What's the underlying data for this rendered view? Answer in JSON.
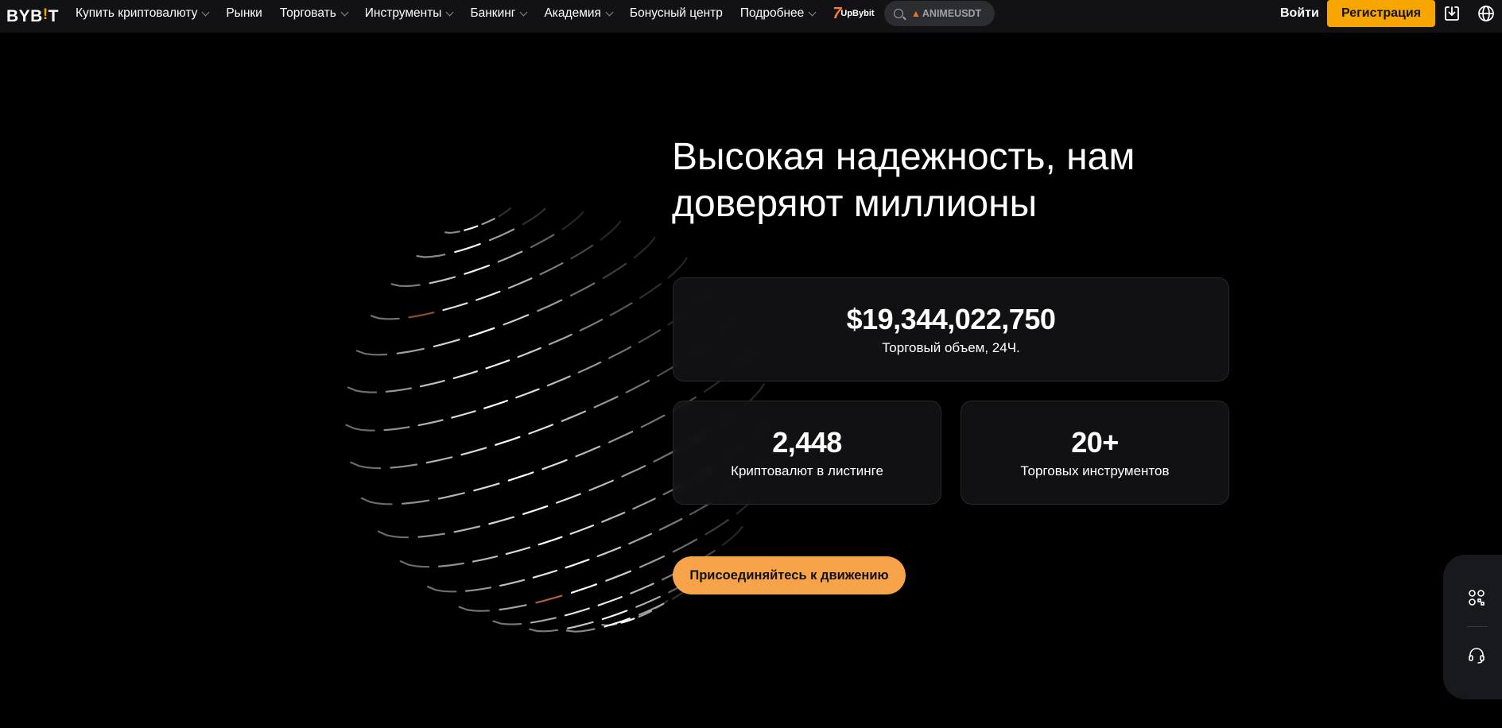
{
  "header": {
    "logo": {
      "text_main": "BYB",
      "text_accent": "!",
      "text_end": "T"
    },
    "nav": [
      {
        "label": "Купить криптовалюту",
        "dropdown": true
      },
      {
        "label": "Рынки",
        "dropdown": false
      },
      {
        "label": "Торговать",
        "dropdown": true
      },
      {
        "label": "Инструменты",
        "dropdown": true
      },
      {
        "label": "Банкинг",
        "dropdown": true
      },
      {
        "label": "Академия",
        "dropdown": true
      },
      {
        "label": "Бонусный центр",
        "dropdown": false
      },
      {
        "label": "Подробнее",
        "dropdown": true
      }
    ],
    "promo": {
      "seven": "7",
      "label": "UpBybit"
    },
    "search": {
      "placeholder": "ANIMEUSDT",
      "icon": "search-icon"
    },
    "login_label": "Войти",
    "register_label": "Регистрация",
    "icons": [
      "download-icon",
      "globe-icon"
    ]
  },
  "hero": {
    "title_line1": "Высокая надежность, нам",
    "title_line2": "доверяют миллионы",
    "stats": [
      {
        "value": "$19,344,022,750",
        "label": "Торговый объем, 24Ч."
      },
      {
        "value": "2,448",
        "label": "Криптовалют в листинге"
      },
      {
        "value": "20+",
        "label": "Торговых инструментов"
      }
    ],
    "cta_label": "Присоединяйтесь к движению"
  },
  "side_panel": {
    "icons": [
      "qr-code-icon",
      "headset-icon"
    ]
  },
  "colors": {
    "brand": "#f7a600",
    "cta": "#f7a34a",
    "header_bg": "#121214",
    "page_bg": "#000000",
    "card_bg": "#18181a"
  }
}
